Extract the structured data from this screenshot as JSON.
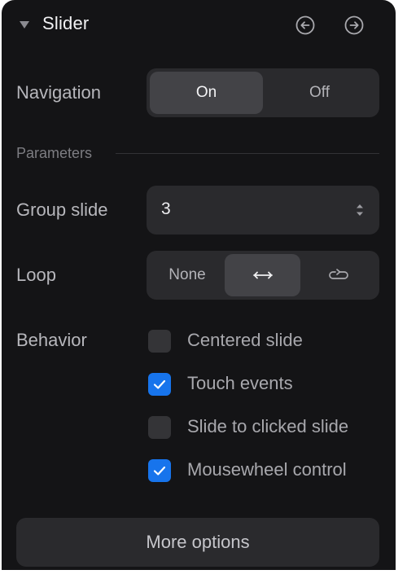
{
  "header": {
    "title": "Slider",
    "collapse_icon": "caret-down-icon",
    "prev_icon": "arrow-left-circle-icon",
    "next_icon": "arrow-right-circle-icon"
  },
  "navigation": {
    "label": "Navigation",
    "options": [
      "On",
      "Off"
    ],
    "selected": "On"
  },
  "parameters": {
    "section_label": "Parameters"
  },
  "group_slide": {
    "label": "Group slide",
    "value": "3",
    "stepper_icon": "up-down-arrows-icon"
  },
  "loop": {
    "label": "Loop",
    "options": [
      "None",
      "bounce-arrows-icon",
      "loop-arrow-icon"
    ],
    "none_label": "None",
    "selected_index": 1
  },
  "behavior": {
    "label": "Behavior",
    "items": [
      {
        "label": "Centered slide",
        "checked": false
      },
      {
        "label": "Touch events",
        "checked": true
      },
      {
        "label": "Slide to clicked slide",
        "checked": false
      },
      {
        "label": "Mousewheel control",
        "checked": true
      }
    ]
  },
  "footer": {
    "more_options_label": "More options"
  },
  "colors": {
    "panel_bg": "#141416",
    "control_bg": "#2a2a2d",
    "active_segment": "#434347",
    "accent": "#1774ec"
  }
}
